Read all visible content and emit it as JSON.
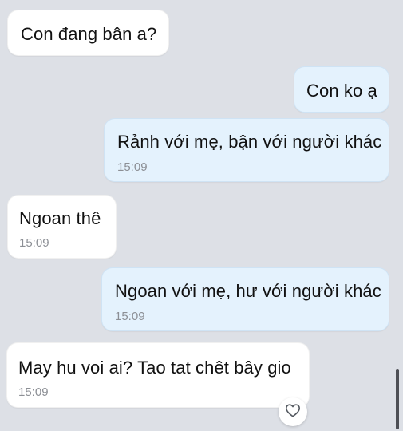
{
  "messages": [
    {
      "direction": "incoming",
      "text": "Con đang bân a?",
      "time": ""
    },
    {
      "direction": "outgoing",
      "text": "Con ko ạ",
      "time": ""
    },
    {
      "direction": "outgoing",
      "text": "Rảnh với mẹ, bận với người khác",
      "time": "15:09"
    },
    {
      "direction": "incoming",
      "text": "Ngoan thê",
      "time": "15:09"
    },
    {
      "direction": "outgoing",
      "text": "Ngoan với mẹ, hư với người khác",
      "time": "15:09"
    },
    {
      "direction": "incoming",
      "text": "May hu voi ai? Tao tat chêt bây gio",
      "time": "15:09"
    }
  ],
  "reaction": {
    "icon": "heart-icon"
  },
  "colors": {
    "background": "#dde0e6",
    "incoming_bubble": "#ffffff",
    "outgoing_bubble": "#e4f2fd",
    "timestamp": "#8c8f95"
  }
}
